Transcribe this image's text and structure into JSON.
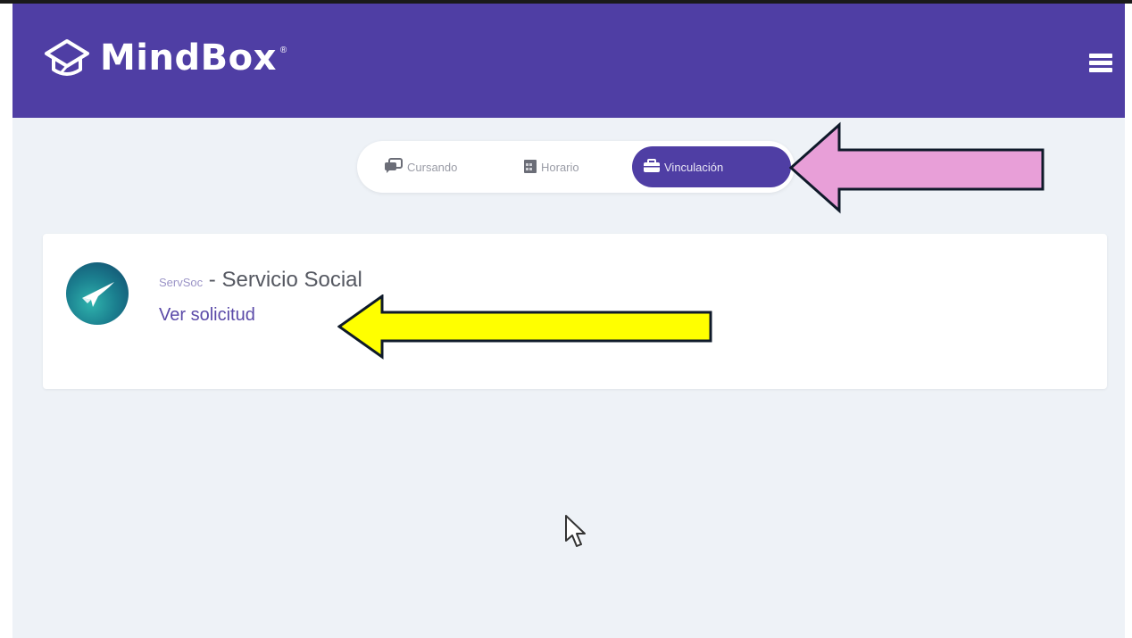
{
  "app": {
    "brand": "MindBox",
    "brand_mark": "®"
  },
  "tabs": [
    {
      "label": "Cursando",
      "icon": "chat-icon",
      "active": false
    },
    {
      "label": "Horario",
      "icon": "calendar-icon",
      "active": false
    },
    {
      "label": "Vinculación",
      "icon": "briefcase-icon",
      "active": true
    }
  ],
  "card": {
    "code": "ServSoc",
    "separator": " - ",
    "title": "Servicio Social",
    "link": "Ver solicitud"
  },
  "colors": {
    "header": "#4f3ea4",
    "background": "#eef2f7",
    "pink_arrow": "#e89fd8",
    "yellow_arrow": "#ffff00"
  }
}
